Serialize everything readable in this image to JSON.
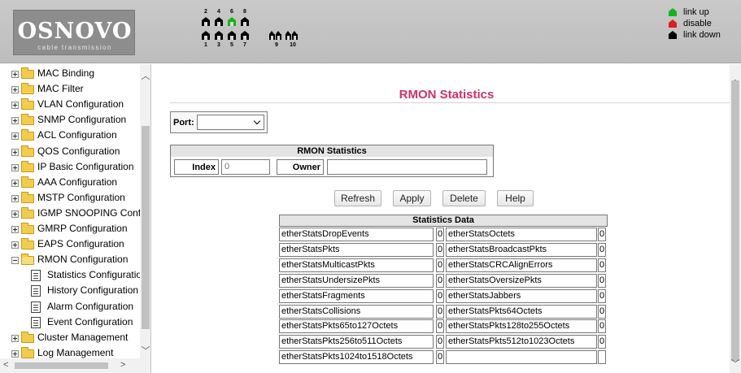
{
  "header": {
    "logo_text": "OSNOVO",
    "logo_subtext": "cable transmission",
    "ports_top_numbers": [
      "2",
      "4",
      "6",
      "8"
    ],
    "ports_bottom_numbers": [
      "1",
      "3",
      "5",
      "7",
      "9",
      "10"
    ],
    "port_status": {
      "1": "down",
      "2": "down",
      "3": "down",
      "4": "down",
      "5": "down",
      "6": "up",
      "7": "down",
      "8": "down",
      "9": "down",
      "10": "down"
    },
    "legend": [
      {
        "label": "link up",
        "color": "#19b319"
      },
      {
        "label": "disable",
        "color": "#e01e1e"
      },
      {
        "label": "link down",
        "color": "#000000"
      }
    ]
  },
  "sidebar": {
    "items": [
      {
        "label": "MAC Binding",
        "type": "folder",
        "expanded": false
      },
      {
        "label": "MAC Filter",
        "type": "folder",
        "expanded": false
      },
      {
        "label": "VLAN Configuration",
        "type": "folder",
        "expanded": false
      },
      {
        "label": "SNMP Configuration",
        "type": "folder",
        "expanded": false
      },
      {
        "label": "ACL Configuration",
        "type": "folder",
        "expanded": false
      },
      {
        "label": "QOS Configuration",
        "type": "folder",
        "expanded": false
      },
      {
        "label": "IP Basic Configuration",
        "type": "folder",
        "expanded": false
      },
      {
        "label": "AAA Configuration",
        "type": "folder",
        "expanded": false
      },
      {
        "label": "MSTP Configuration",
        "type": "folder",
        "expanded": false
      },
      {
        "label": "IGMP SNOOPING Confi",
        "type": "folder",
        "expanded": false
      },
      {
        "label": "GMRP Configuration",
        "type": "folder",
        "expanded": false
      },
      {
        "label": "EAPS Configuration",
        "type": "folder",
        "expanded": false
      },
      {
        "label": "RMON Configuration",
        "type": "folder",
        "expanded": true
      },
      {
        "label": "Statistics Configuratio",
        "type": "page"
      },
      {
        "label": "History Configuration",
        "type": "page"
      },
      {
        "label": "Alarm Configuration",
        "type": "page"
      },
      {
        "label": "Event Configuration",
        "type": "page"
      },
      {
        "label": "Cluster Management",
        "type": "folder",
        "expanded": false
      },
      {
        "label": "Log Management",
        "type": "folder",
        "expanded": false
      }
    ]
  },
  "main": {
    "title": "RMON Statistics",
    "port_label": "Port:",
    "port_value": "",
    "rmon_section_title": "RMON Statistics",
    "index_label": "Index",
    "index_value": "0",
    "owner_label": "Owner",
    "owner_value": "",
    "buttons": {
      "refresh": "Refresh",
      "apply": "Apply",
      "delete": "Delete",
      "help": "Help"
    },
    "stats_title": "Statistics Data",
    "stats_rows": [
      {
        "left_name": "etherStatsDropEvents",
        "left_value": "0",
        "right_name": "etherStatsOctets",
        "right_value": "0"
      },
      {
        "left_name": "etherStatsPkts",
        "left_value": "0",
        "right_name": "etherStatsBroadcastPkts",
        "right_value": "0"
      },
      {
        "left_name": "etherStatsMulticastPkts",
        "left_value": "0",
        "right_name": "etherStatsCRCAlignErrors",
        "right_value": "0"
      },
      {
        "left_name": "etherStatsUndersizePkts",
        "left_value": "0",
        "right_name": "etherStatsOversizePkts",
        "right_value": "0"
      },
      {
        "left_name": "etherStatsFragments",
        "left_value": "0",
        "right_name": "etherStatsJabbers",
        "right_value": "0"
      },
      {
        "left_name": "etherStatsCollisions",
        "left_value": "0",
        "right_name": "etherStatsPkts64Octets",
        "right_value": "0"
      },
      {
        "left_name": "etherStatsPkts65to127Octets",
        "left_value": "0",
        "right_name": "etherStatsPkts128to255Octets",
        "right_value": "0"
      },
      {
        "left_name": "etherStatsPkts256to511Octets",
        "left_value": "0",
        "right_name": "etherStatsPkts512to1023Octets",
        "right_value": "0"
      },
      {
        "left_name": "etherStatsPkts1024to1518Octets",
        "left_value": "0",
        "right_name": "",
        "right_value": ""
      }
    ]
  }
}
